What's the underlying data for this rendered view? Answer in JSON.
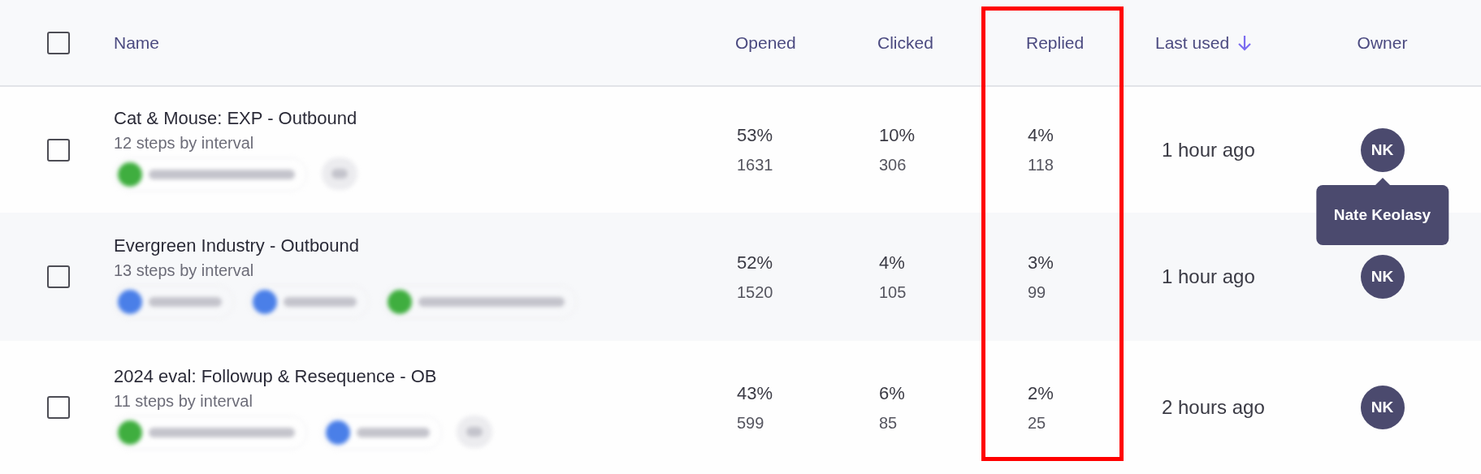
{
  "header": {
    "select_all": {
      "checked": false
    },
    "columns": [
      {
        "label": "Name",
        "sorted": false,
        "highlighted": false
      },
      {
        "label": "Opened",
        "sorted": false,
        "highlighted": false
      },
      {
        "label": "Clicked",
        "sorted": false,
        "highlighted": false
      },
      {
        "label": "Replied",
        "sorted": false,
        "highlighted": true
      },
      {
        "label": "Last used",
        "sorted": true,
        "highlighted": false
      },
      {
        "label": "Owner",
        "sorted": false,
        "highlighted": false
      }
    ]
  },
  "rows": [
    {
      "checked": false,
      "name": "Cat & Mouse: EXP - Outbound",
      "steps": "12 steps by interval",
      "tags": [
        {
          "kind": "label",
          "color": "#3fae3f"
        },
        {
          "kind": "more"
        }
      ],
      "opened": [
        "53%",
        "1631"
      ],
      "clicked": [
        "10%",
        "306"
      ],
      "replied": [
        "4%",
        "118"
      ],
      "last_used": "1 hour ago",
      "owner": "NK",
      "tooltip": "Nate Keolasy"
    },
    {
      "checked": false,
      "name": "Evergreen Industry - Outbound",
      "steps": "13 steps by interval",
      "tags": [
        {
          "kind": "label",
          "color": "#4a7fe8"
        },
        {
          "kind": "label",
          "color": "#4a7fe8"
        },
        {
          "kind": "label",
          "color": "#3fae3f"
        }
      ],
      "opened": [
        "52%",
        "1520"
      ],
      "clicked": [
        "4%",
        "105"
      ],
      "replied": [
        "3%",
        "99"
      ],
      "last_used": "1 hour ago",
      "owner": "NK"
    },
    {
      "checked": false,
      "name": "2024 eval: Followup & Resequence - OB",
      "steps": "11 steps by interval",
      "tags": [
        {
          "kind": "label",
          "color": "#3fae3f"
        },
        {
          "kind": "label",
          "color": "#4a7fe8"
        },
        {
          "kind": "more"
        }
      ],
      "opened": [
        "43%",
        "599"
      ],
      "clicked": [
        "6%",
        "85"
      ],
      "replied": [
        "2%",
        "25"
      ],
      "last_used": "2 hours ago",
      "owner": "NK"
    }
  ]
}
